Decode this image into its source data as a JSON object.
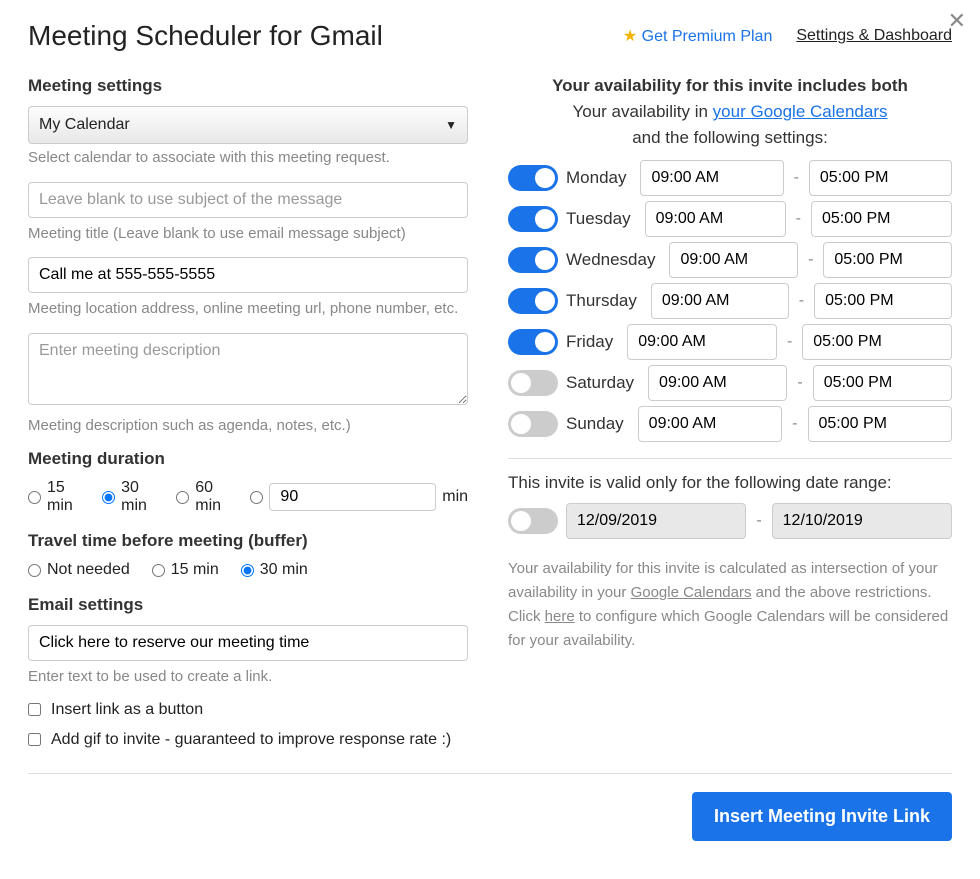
{
  "header": {
    "title": "Meeting Scheduler for Gmail",
    "premium_label": "Get Premium Plan",
    "settings_label": "Settings & Dashboard"
  },
  "left": {
    "meeting_settings_heading": "Meeting settings",
    "calendar_selected": "My Calendar",
    "calendar_help": "Select calendar to associate with this meeting request.",
    "title_placeholder": "Leave blank to use subject of the message",
    "title_help": "Meeting title (Leave blank to use email message subject)",
    "location_value": "Call me at 555-555-5555",
    "location_help": "Meeting location address, online meeting url, phone number, etc.",
    "description_placeholder": "Enter meeting description",
    "description_help": "Meeting description such as agenda, notes, etc.)",
    "duration_heading": "Meeting duration",
    "duration_15": "15 min",
    "duration_30": "30 min",
    "duration_60": "60 min",
    "duration_custom_value": "90",
    "duration_custom_unit": "min",
    "buffer_heading": "Travel time before meeting (buffer)",
    "buffer_none": "Not needed",
    "buffer_15": "15 min",
    "buffer_30": "30 min",
    "email_heading": "Email settings",
    "link_text_value": "Click here to reserve our meeting time",
    "link_text_help": "Enter text to be used to create a link.",
    "check_button_label": "Insert link as a button",
    "check_gif_label": "Add gif to invite - guaranteed to improve response rate :)"
  },
  "right": {
    "avail_heading": "Your availability for this invite includes both",
    "avail_sub_prefix": "Your availability in ",
    "avail_sub_link": "your Google Calendars",
    "avail_sub_suffix": "and the following settings:",
    "days": [
      {
        "name": "Monday",
        "on": true,
        "start": "09:00 AM",
        "end": "05:00 PM"
      },
      {
        "name": "Tuesday",
        "on": true,
        "start": "09:00 AM",
        "end": "05:00 PM"
      },
      {
        "name": "Wednesday",
        "on": true,
        "start": "09:00 AM",
        "end": "05:00 PM"
      },
      {
        "name": "Thursday",
        "on": true,
        "start": "09:00 AM",
        "end": "05:00 PM"
      },
      {
        "name": "Friday",
        "on": true,
        "start": "09:00 AM",
        "end": "05:00 PM"
      },
      {
        "name": "Saturday",
        "on": false,
        "start": "09:00 AM",
        "end": "05:00 PM"
      },
      {
        "name": "Sunday",
        "on": false,
        "start": "09:00 AM",
        "end": "05:00 PM"
      }
    ],
    "date_range_label": "This invite is valid only for the following date range:",
    "date_from": "12/09/2019",
    "date_to": "12/10/2019",
    "disclaimer_p1": "Your availability for this invite is calculated as intersection of your availability in your ",
    "disclaimer_gc": "Google Calendars",
    "disclaimer_p2": " and the above restrictions. Click ",
    "disclaimer_here": "here",
    "disclaimer_p3": " to configure which Google Calendars will be considered for your availability."
  },
  "footer": {
    "insert_button": "Insert Meeting Invite Link"
  }
}
